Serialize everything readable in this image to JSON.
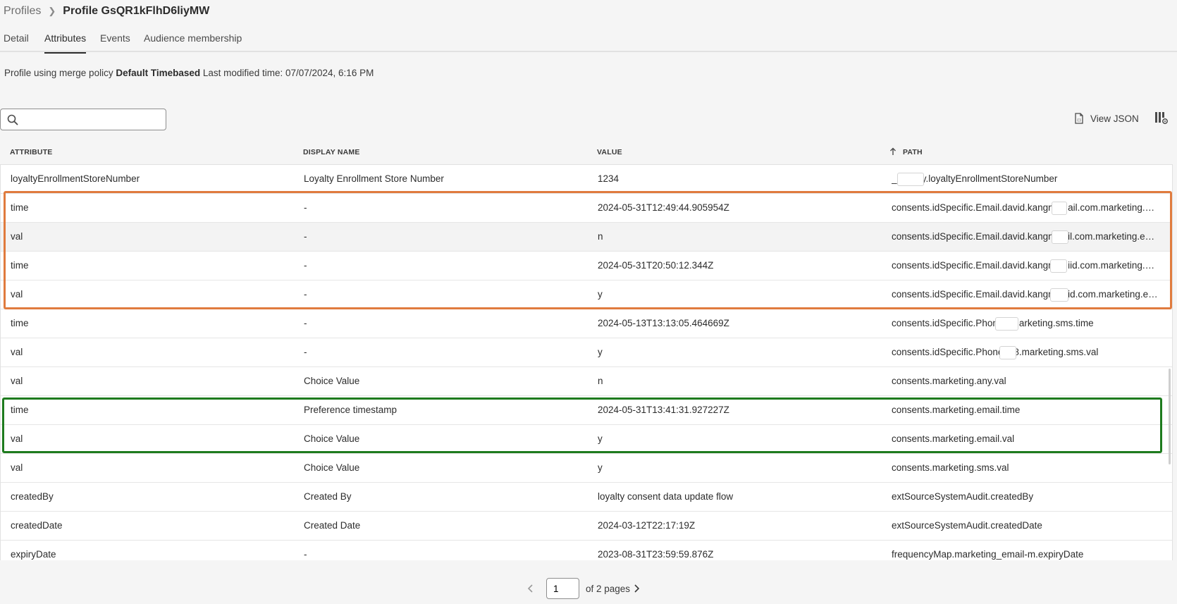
{
  "breadcrumb": {
    "parent": "Profiles",
    "current": "Profile GsQR1kFlhD6liyMW"
  },
  "tabs": [
    "Detail",
    "Attributes",
    "Events",
    "Audience membership"
  ],
  "active_tab": "Attributes",
  "merge_info": {
    "prefix": "Profile using merge policy",
    "policy": "Default Timebased",
    "modified_label": "Last modified time:",
    "modified_value": "07/07/2024, 6:16 PM"
  },
  "search": {
    "placeholder": "",
    "value": ""
  },
  "toolbar": {
    "view_json_label": "View JSON"
  },
  "columns": {
    "attribute": "ATTRIBUTE",
    "display_name": "DISPLAY NAME",
    "value": "VALUE",
    "path": "PATH"
  },
  "rows": [
    {
      "attribute": "loyaltyEnrollmentStoreNumber",
      "display_name": "Loyalty Enrollment Store Number",
      "value": "1234",
      "path": "_        loyalty.loyaltyEnrollmentStoreNumber"
    },
    {
      "attribute": "time",
      "display_name": "-",
      "value": "2024-05-31T12:49:44.905954Z",
      "path": "consents.idSpecific.Email.david.kangni@      ail.com.marketing.em..."
    },
    {
      "attribute": "val",
      "display_name": "-",
      "value": "n",
      "path": "consents.idSpecific.Email.david.kangni@       il.com.marketing.em..."
    },
    {
      "attribute": "time",
      "display_name": "-",
      "value": "2024-05-31T20:50:12.344Z",
      "path": "consents.idSpecific.Email.david.kangni@      iid.com.marketing.em..."
    },
    {
      "attribute": "val",
      "display_name": "-",
      "value": "y",
      "path": "consents.idSpecific.Email.david.kangni@       id.com.marketing.em..."
    },
    {
      "attribute": "time",
      "display_name": "-",
      "value": "2024-05-13T13:13:05.464669Z",
      "path": "consents.idSpecific.Phone.       .marketing.sms.time"
    },
    {
      "attribute": "val",
      "display_name": "-",
      "value": "y",
      "path": "consents.idSpecific.Phone.7      8.marketing.sms.val"
    },
    {
      "attribute": "val",
      "display_name": "Choice Value",
      "value": "n",
      "path": "consents.marketing.any.val"
    },
    {
      "attribute": "time",
      "display_name": "Preference timestamp",
      "value": "2024-05-31T13:41:31.927227Z",
      "path": "consents.marketing.email.time"
    },
    {
      "attribute": "val",
      "display_name": "Choice Value",
      "value": "y",
      "path": "consents.marketing.email.val"
    },
    {
      "attribute": "val",
      "display_name": "Choice Value",
      "value": "y",
      "path": "consents.marketing.sms.val"
    },
    {
      "attribute": "createdBy",
      "display_name": "Created By",
      "value": "loyalty consent data update flow",
      "path": "extSourceSystemAudit.createdBy"
    },
    {
      "attribute": "createdDate",
      "display_name": "Created Date",
      "value": "2024-03-12T22:17:19Z",
      "path": "extSourceSystemAudit.createdDate"
    },
    {
      "attribute": "expiryDate",
      "display_name": "-",
      "value": "2023-08-31T23:59:59.876Z",
      "path": "frequencyMap.marketing_email-m.expiryDate"
    }
  ],
  "pagination": {
    "current_page": "1",
    "of_label": "of 2 pages"
  },
  "colors": {
    "highlight_orange": "#e07b3e",
    "highlight_green": "#1e7b1e"
  }
}
